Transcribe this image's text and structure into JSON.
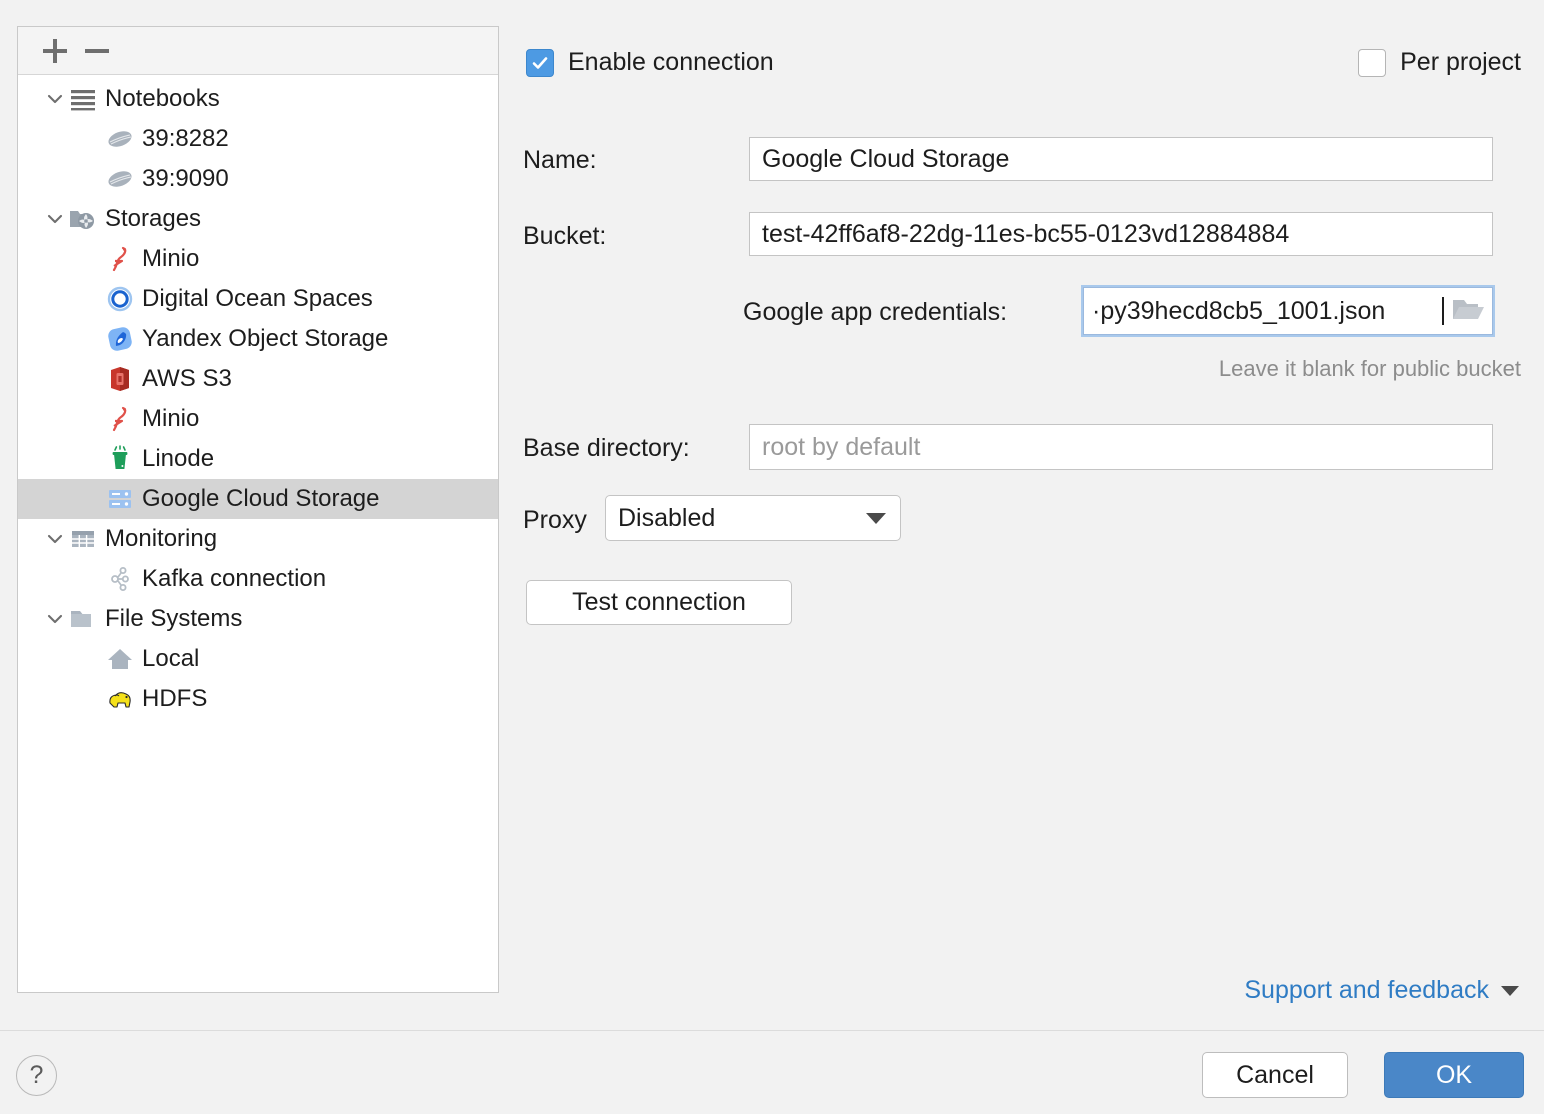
{
  "tree": {
    "toolbar": {
      "add_label": "+",
      "remove_label": "−"
    },
    "items": [
      {
        "label": "Notebooks",
        "icon": "notebooks-icon",
        "level": 0,
        "expandable": true,
        "expanded": true,
        "selected": false
      },
      {
        "label": "39:8282",
        "icon": "notebook-icon",
        "level": 1,
        "expandable": false,
        "expanded": false,
        "selected": false
      },
      {
        "label": "39:9090",
        "icon": "notebook-icon",
        "level": 1,
        "expandable": false,
        "expanded": false,
        "selected": false
      },
      {
        "label": "Storages",
        "icon": "storages-icon",
        "level": 0,
        "expandable": true,
        "expanded": true,
        "selected": false
      },
      {
        "label": "Minio",
        "icon": "minio-icon",
        "level": 1,
        "expandable": false,
        "expanded": false,
        "selected": false
      },
      {
        "label": "Digital Ocean Spaces",
        "icon": "digitalocean-icon",
        "level": 1,
        "expandable": false,
        "expanded": false,
        "selected": false
      },
      {
        "label": "Yandex Object Storage",
        "icon": "yandex-icon",
        "level": 1,
        "expandable": false,
        "expanded": false,
        "selected": false
      },
      {
        "label": "AWS S3",
        "icon": "aws-s3-icon",
        "level": 1,
        "expandable": false,
        "expanded": false,
        "selected": false
      },
      {
        "label": "Minio",
        "icon": "minio-icon",
        "level": 1,
        "expandable": false,
        "expanded": false,
        "selected": false
      },
      {
        "label": "Linode",
        "icon": "linode-icon",
        "level": 1,
        "expandable": false,
        "expanded": false,
        "selected": false
      },
      {
        "label": "Google Cloud Storage",
        "icon": "gcs-icon",
        "level": 1,
        "expandable": false,
        "expanded": false,
        "selected": true
      },
      {
        "label": "Monitoring",
        "icon": "monitoring-icon",
        "level": 0,
        "expandable": true,
        "expanded": true,
        "selected": false
      },
      {
        "label": "Kafka connection",
        "icon": "kafka-icon",
        "level": 1,
        "expandable": false,
        "expanded": false,
        "selected": false
      },
      {
        "label": "File Systems",
        "icon": "folder-icon",
        "level": 0,
        "expandable": true,
        "expanded": true,
        "selected": false
      },
      {
        "label": "Local",
        "icon": "home-icon",
        "level": 1,
        "expandable": false,
        "expanded": false,
        "selected": false
      },
      {
        "label": "HDFS",
        "icon": "hdfs-icon",
        "level": 1,
        "expandable": false,
        "expanded": false,
        "selected": false
      }
    ]
  },
  "form": {
    "enable_connection": {
      "label": "Enable connection",
      "checked": true
    },
    "per_project": {
      "label": "Per project",
      "checked": false
    },
    "name": {
      "label": "Name:",
      "value": "Google Cloud Storage"
    },
    "bucket": {
      "label": "Bucket:",
      "value": "test-42ff6af8-22dg-11es-bc55-0123vd12884884"
    },
    "credentials": {
      "label": "Google app credentials:",
      "value": "·py39hecd8cb5_1001.json",
      "hint": "Leave it blank for public bucket",
      "browse_icon": "folder-open-icon",
      "focused": true
    },
    "base_directory": {
      "label": "Base directory:",
      "value": "",
      "placeholder": "root by default"
    },
    "proxy": {
      "label": "Proxy",
      "value": "Disabled",
      "options": [
        "Disabled"
      ]
    },
    "test_connection": {
      "label": "Test connection"
    },
    "support": {
      "label": "Support and feedback"
    }
  },
  "footer": {
    "help": {
      "label": "?"
    },
    "cancel": {
      "label": "Cancel"
    },
    "ok": {
      "label": "OK"
    }
  },
  "colors": {
    "accent": "#4a87c8",
    "checkbox_on": "#4d9ae3",
    "link": "#2f7cc4",
    "selection": "#d4d4d4",
    "background": "#f2f2f2"
  }
}
